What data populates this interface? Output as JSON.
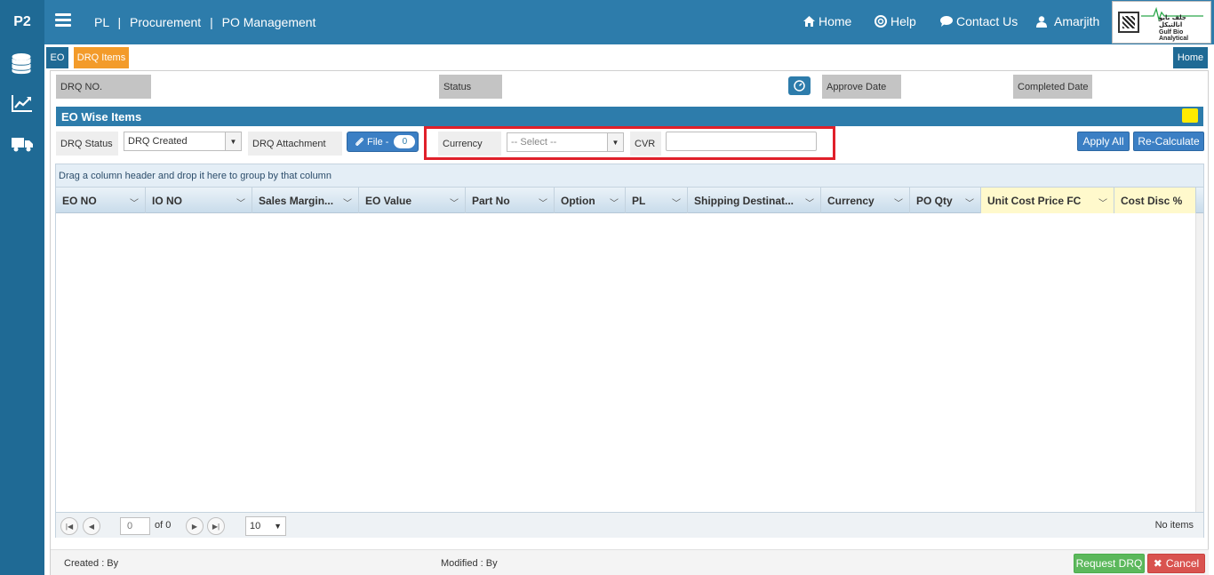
{
  "app": {
    "brand": "P2"
  },
  "breadcrumb": [
    "PL",
    "Procurement",
    "PO Management"
  ],
  "nav": {
    "home": "Home",
    "help": "Help",
    "contact": "Contact Us",
    "user": "Amarjith"
  },
  "logo": {
    "arabic": "جلف بايو انالتيكل",
    "english": "Gulf Bio Analytical"
  },
  "sidebar": {
    "icons": [
      "database-icon",
      "chart-line-icon",
      "truck-icon"
    ]
  },
  "tabs": {
    "eo": "EO",
    "drq_items": "DRQ Items",
    "home": "Home"
  },
  "header_fields": {
    "drq_no_label": "DRQ NO.",
    "status_label": "Status",
    "approve_date_label": "Approve Date",
    "completed_date_label": "Completed Date"
  },
  "section": {
    "title": "EO Wise Items"
  },
  "form": {
    "drq_status_label": "DRQ Status",
    "drq_status_value": "DRQ Created",
    "drq_attachment_label": "DRQ Attachment",
    "file_button_label": "File -",
    "file_count": "0",
    "currency_label": "Currency",
    "currency_placeholder": "-- Select --",
    "cvr_label": "CVR",
    "cvr_value": "",
    "apply_all_label": "Apply All",
    "recalculate_label": "Re-Calculate"
  },
  "grid": {
    "group_hint": "Drag a column header and drop it here to group by that column",
    "columns": [
      "EO NO",
      "IO NO",
      "Sales Margin...",
      "EO Value",
      "Part No",
      "Option",
      "PL",
      "Shipping Destinat...",
      "Currency",
      "PO Qty",
      "Unit Cost Price FC",
      "Cost Disc %"
    ],
    "rows": []
  },
  "pager": {
    "page_value": "0",
    "of_text": "of 0",
    "page_size": "10",
    "status": "No items"
  },
  "footer": {
    "created_label": "Created : By",
    "modified_label": "Modified : By",
    "request_label": "Request DRQ",
    "cancel_label": "Cancel"
  },
  "colors": {
    "topbar": "#2d7cab",
    "sidebar": "#1f6a95",
    "tab_active": "#f39b2a",
    "highlight_box": "#e0202a",
    "success": "#5cb85c",
    "danger": "#d9534f",
    "indicator": "#ffeb00"
  }
}
